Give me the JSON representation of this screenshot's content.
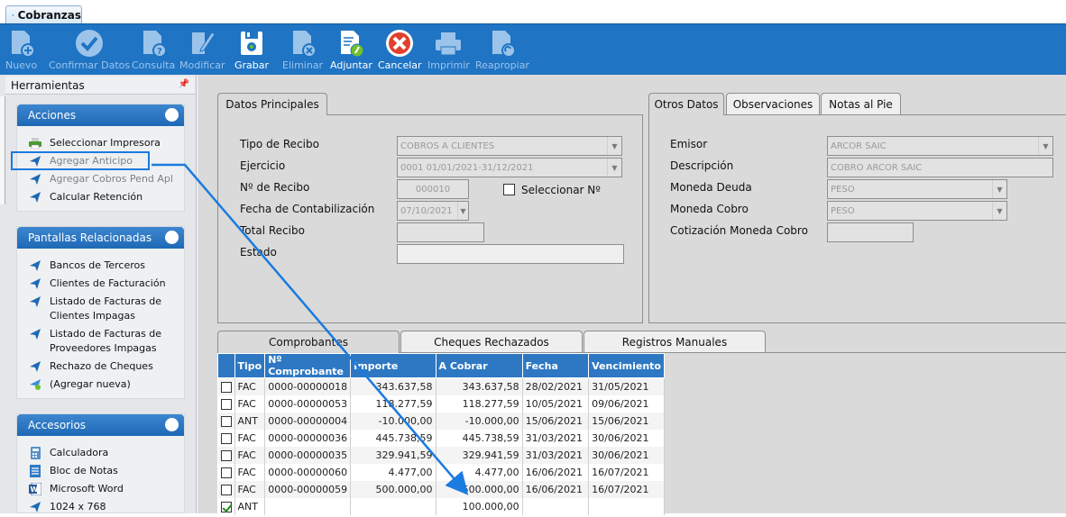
{
  "window": {
    "tab_title": "Cobranzas"
  },
  "toolbar": {
    "buttons": [
      {
        "label": "Nuevo",
        "icon": "new-doc-icon",
        "enabled": false
      },
      {
        "label": "Confirmar Datos",
        "icon": "check-circle-icon",
        "enabled": false
      },
      {
        "label": "Consulta",
        "icon": "query-doc-icon",
        "enabled": false
      },
      {
        "label": "Modificar",
        "icon": "edit-doc-icon",
        "enabled": false
      },
      {
        "label": "Grabar",
        "icon": "save-icon",
        "enabled": true
      },
      {
        "label": "Eliminar",
        "icon": "delete-doc-icon",
        "enabled": false
      },
      {
        "label": "Adjuntar",
        "icon": "attach-doc-icon",
        "enabled": true
      },
      {
        "label": "Cancelar",
        "icon": "cancel-icon",
        "enabled": true
      },
      {
        "label": "Imprimir",
        "icon": "printer-icon",
        "enabled": false
      },
      {
        "label": "Reapropiar",
        "icon": "reassign-doc-icon",
        "enabled": false
      }
    ]
  },
  "sidebar": {
    "title": "Herramientas",
    "groups": [
      {
        "title": "Acciones",
        "items": [
          {
            "label": "Seleccionar Impresora",
            "icon": "printer-icon",
            "enabled": true
          },
          {
            "label": "Agregar Anticipo",
            "icon": "nav-arrow-icon",
            "enabled": false
          },
          {
            "label": "Agregar Cobros Pend Apl",
            "icon": "nav-arrow-icon",
            "enabled": false
          },
          {
            "label": "Calcular Retención",
            "icon": "nav-arrow-icon",
            "enabled": true
          }
        ]
      },
      {
        "title": "Pantallas Relacionadas",
        "items": [
          {
            "label": "Bancos de Terceros",
            "icon": "nav-arrow-icon"
          },
          {
            "label": "Clientes de Facturación",
            "icon": "nav-arrow-icon"
          },
          {
            "label": "Listado de Facturas de Clientes Impagas",
            "icon": "nav-arrow-icon"
          },
          {
            "label": "Listado de Facturas de Proveedores Impagas",
            "icon": "nav-arrow-icon"
          },
          {
            "label": "Rechazo de Cheques",
            "icon": "nav-arrow-icon"
          },
          {
            "label": "(Agregar nueva)",
            "icon": "add-nav-icon"
          }
        ]
      },
      {
        "title": "Accesorios",
        "items": [
          {
            "label": "Calculadora",
            "icon": "calculator-icon"
          },
          {
            "label": "Bloc de Notas",
            "icon": "notepad-icon"
          },
          {
            "label": "Microsoft Word",
            "icon": "word-icon"
          },
          {
            "label": "1024 x 768",
            "icon": "nav-arrow-icon"
          }
        ]
      }
    ]
  },
  "datos_principales": {
    "tab": "Datos Principales",
    "tipo_label": "Tipo de Recibo",
    "tipo_value": "COBROS A CLIENTES",
    "ejercicio_label": "Ejercicio",
    "ejercicio_value": "0001 01/01/2021-31/12/2021",
    "recibo_label": "Nº de Recibo",
    "recibo_value": "000010",
    "seleccionar_label": "Seleccionar Nº",
    "fecha_label": "Fecha de Contabilización",
    "fecha_value": "07/10/2021",
    "total_label": "Total Recibo",
    "estado_label": "Estado"
  },
  "otros": {
    "tabs": [
      "Otros Datos",
      "Observaciones",
      "Notas al Pie"
    ],
    "emisor_label": "Emisor",
    "emisor_value": "ARCOR SAIC",
    "descripcion_label": "Descripción",
    "descripcion_value": "COBRO ARCOR SAIC",
    "moneda_deuda_label": "Moneda Deuda",
    "moneda_deuda_value": "PESO",
    "moneda_cobro_label": "Moneda Cobro",
    "moneda_cobro_value": "PESO",
    "cotizacion_label": "Cotización Moneda Cobro"
  },
  "grid": {
    "tabs": [
      "Comprobantes",
      "Cheques Rechazados",
      "Registros Manuales"
    ],
    "columns": [
      "",
      "Tipo",
      "Nº Comprobante",
      "Importe",
      "A Cobrar",
      "Fecha",
      "Vencimiento"
    ],
    "rows": [
      {
        "checked": false,
        "tipo": "FAC",
        "comprobante": "0000-00000018",
        "importe": "343.637,58",
        "a_cobrar": "343.637,58",
        "fecha": "28/02/2021",
        "vencimiento": "31/05/2021"
      },
      {
        "checked": false,
        "tipo": "FAC",
        "comprobante": "0000-00000053",
        "importe": "118.277,59",
        "a_cobrar": "118.277,59",
        "fecha": "10/05/2021",
        "vencimiento": "09/06/2021"
      },
      {
        "checked": false,
        "tipo": "ANT",
        "comprobante": "0000-00000004",
        "importe": "-10.000,00",
        "a_cobrar": "-10.000,00",
        "fecha": "15/06/2021",
        "vencimiento": "15/06/2021"
      },
      {
        "checked": false,
        "tipo": "FAC",
        "comprobante": "0000-00000036",
        "importe": "445.738,59",
        "a_cobrar": "445.738,59",
        "fecha": "31/03/2021",
        "vencimiento": "30/06/2021"
      },
      {
        "checked": false,
        "tipo": "FAC",
        "comprobante": "0000-00000035",
        "importe": "329.941,59",
        "a_cobrar": "329.941,59",
        "fecha": "31/03/2021",
        "vencimiento": "30/06/2021"
      },
      {
        "checked": false,
        "tipo": "FAC",
        "comprobante": "0000-00000060",
        "importe": "4.477,00",
        "a_cobrar": "4.477,00",
        "fecha": "16/06/2021",
        "vencimiento": "16/07/2021"
      },
      {
        "checked": false,
        "tipo": "FAC",
        "comprobante": "0000-00000059",
        "importe": "500.000,00",
        "a_cobrar": "500.000,00",
        "fecha": "16/06/2021",
        "vencimiento": "16/07/2021"
      },
      {
        "checked": true,
        "tipo": "ANT",
        "comprobante": "",
        "importe": "",
        "a_cobrar": "100.000,00",
        "fecha": "",
        "vencimiento": ""
      }
    ]
  },
  "colors": {
    "toolbar": "#1f74c4",
    "group_header": "#2a75c2",
    "grid_header": "#2e78c3",
    "annotation": "#1a7be0"
  }
}
